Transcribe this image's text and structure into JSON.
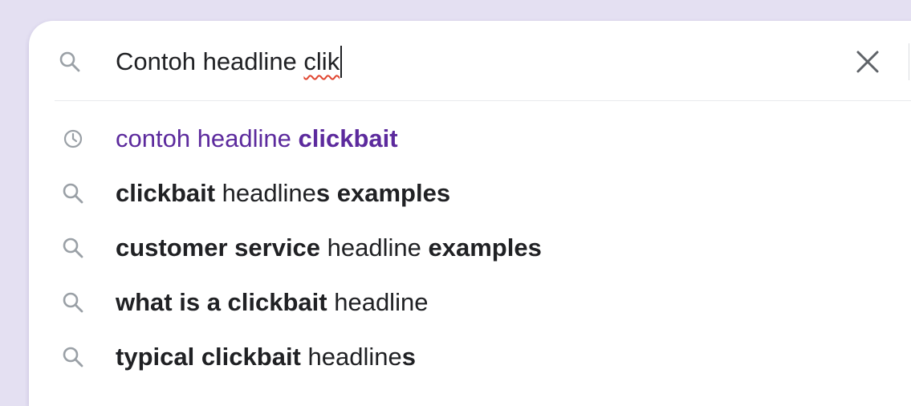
{
  "search": {
    "query_parts": [
      {
        "text": "Contoh headline ",
        "misspelled": false
      },
      {
        "text": "clik",
        "misspelled": true
      }
    ],
    "value": "Contoh headline clik",
    "clear_icon": "close-icon",
    "search_icon": "search-icon"
  },
  "suggestions": [
    {
      "type": "history",
      "icon": "history-clock-icon",
      "parts": [
        {
          "text": "contoh headline ",
          "bold": false
        },
        {
          "text": "clickbait",
          "bold": true
        }
      ]
    },
    {
      "type": "search",
      "icon": "search-icon",
      "parts": [
        {
          "text": "clickbait",
          "bold": true
        },
        {
          "text": " headline",
          "bold": false
        },
        {
          "text": "s examples",
          "bold": true
        }
      ]
    },
    {
      "type": "search",
      "icon": "search-icon",
      "parts": [
        {
          "text": "customer service",
          "bold": true
        },
        {
          "text": " headline ",
          "bold": false
        },
        {
          "text": "examples",
          "bold": true
        }
      ]
    },
    {
      "type": "search",
      "icon": "search-icon",
      "parts": [
        {
          "text": "what is a clickbait",
          "bold": true
        },
        {
          "text": " headline",
          "bold": false
        }
      ]
    },
    {
      "type": "search",
      "icon": "search-icon",
      "parts": [
        {
          "text": "typical clickbait",
          "bold": true
        },
        {
          "text": " headline",
          "bold": false
        },
        {
          "text": "s",
          "bold": true
        }
      ]
    }
  ],
  "colors": {
    "background": "#e4e0f2",
    "history_text": "#5c2a9d",
    "text": "#202124",
    "icon": "#9aa0a6",
    "spell_underline": "#e0452f"
  }
}
